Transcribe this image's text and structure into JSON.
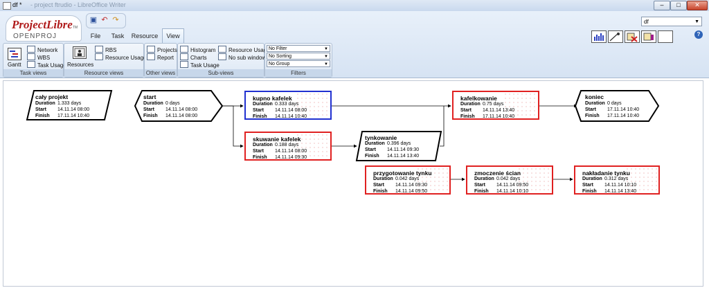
{
  "window": {
    "title": "df *",
    "subtitle": "- project ftrudio - LibreOffice Writer"
  },
  "logo": {
    "main": "ProjectLibre",
    "tm": "TM",
    "sub": "OPENPROJ"
  },
  "menu_tabs": [
    "File",
    "Task",
    "Resource",
    "View"
  ],
  "project_select": "df",
  "help_label": "?",
  "ribbon": {
    "task_views": {
      "label": "Task views",
      "gantt": "Gantt",
      "items": [
        "Network",
        "WBS",
        "Task Usage"
      ]
    },
    "resource_views": {
      "label": "Resource views",
      "resources": "Resources",
      "items": [
        "RBS",
        "Resource Usage"
      ]
    },
    "other_views": {
      "label": "Other views",
      "items": [
        "Projects",
        "Report"
      ]
    },
    "sub_views": {
      "label": "Sub-views",
      "col1": [
        "Histogram",
        "Charts",
        "Task Usage"
      ],
      "col2": [
        "Resource Usage",
        "No sub window"
      ]
    },
    "filters": {
      "label": "Filters",
      "filter": "No Filter",
      "sorting": "No Sorting",
      "group": "No Group"
    }
  },
  "labels": {
    "duration": "Duration",
    "start": "Start",
    "finish": "Finish"
  },
  "nodes": [
    {
      "name": "cały projekt",
      "duration": "1.333 days",
      "start": "14.11.14 08:00",
      "finish": "17.11.14 10:40"
    },
    {
      "name": "start",
      "duration": "0 days",
      "start": "14.11.14 08:00",
      "finish": "14.11.14 08:00"
    },
    {
      "name": "kupno kafelek",
      "duration": "0.333 days",
      "start": "14.11.14 08:00",
      "finish": "14.11.14 10:40"
    },
    {
      "name": "skuwanie kafelek",
      "duration": "0.188 days",
      "start": "14.11.14 08:00",
      "finish": "14.11.14 09:30"
    },
    {
      "name": "tynkowanie",
      "duration": "0.396 days",
      "start": "14.11.14 09:30",
      "finish": "14.11.14 13:40"
    },
    {
      "name": "kafelkowanie",
      "duration": "0.75 days",
      "start": "14.11.14 13:40",
      "finish": "17.11.14 10:40"
    },
    {
      "name": "koniec",
      "duration": "0 days",
      "start": "17.11.14 10:40",
      "finish": "17.11.14 10:40"
    },
    {
      "name": "przygotowanie tynku",
      "duration": "0.042 days",
      "start": "14.11.14 09:30",
      "finish": "14.11.14 09:50"
    },
    {
      "name": "zmoczenie ścian",
      "duration": "0.042 days",
      "start": "14.11.14 09:50",
      "finish": "14.11.14 10:10"
    },
    {
      "name": "nakładanie tynku",
      "duration": "0.312 days",
      "start": "14.11.14 10:10",
      "finish": "14.11.14 13:40"
    }
  ],
  "colors": {
    "critical": "#e02020",
    "selected": "#2030d0",
    "ribbon": "#d6e3f3"
  }
}
